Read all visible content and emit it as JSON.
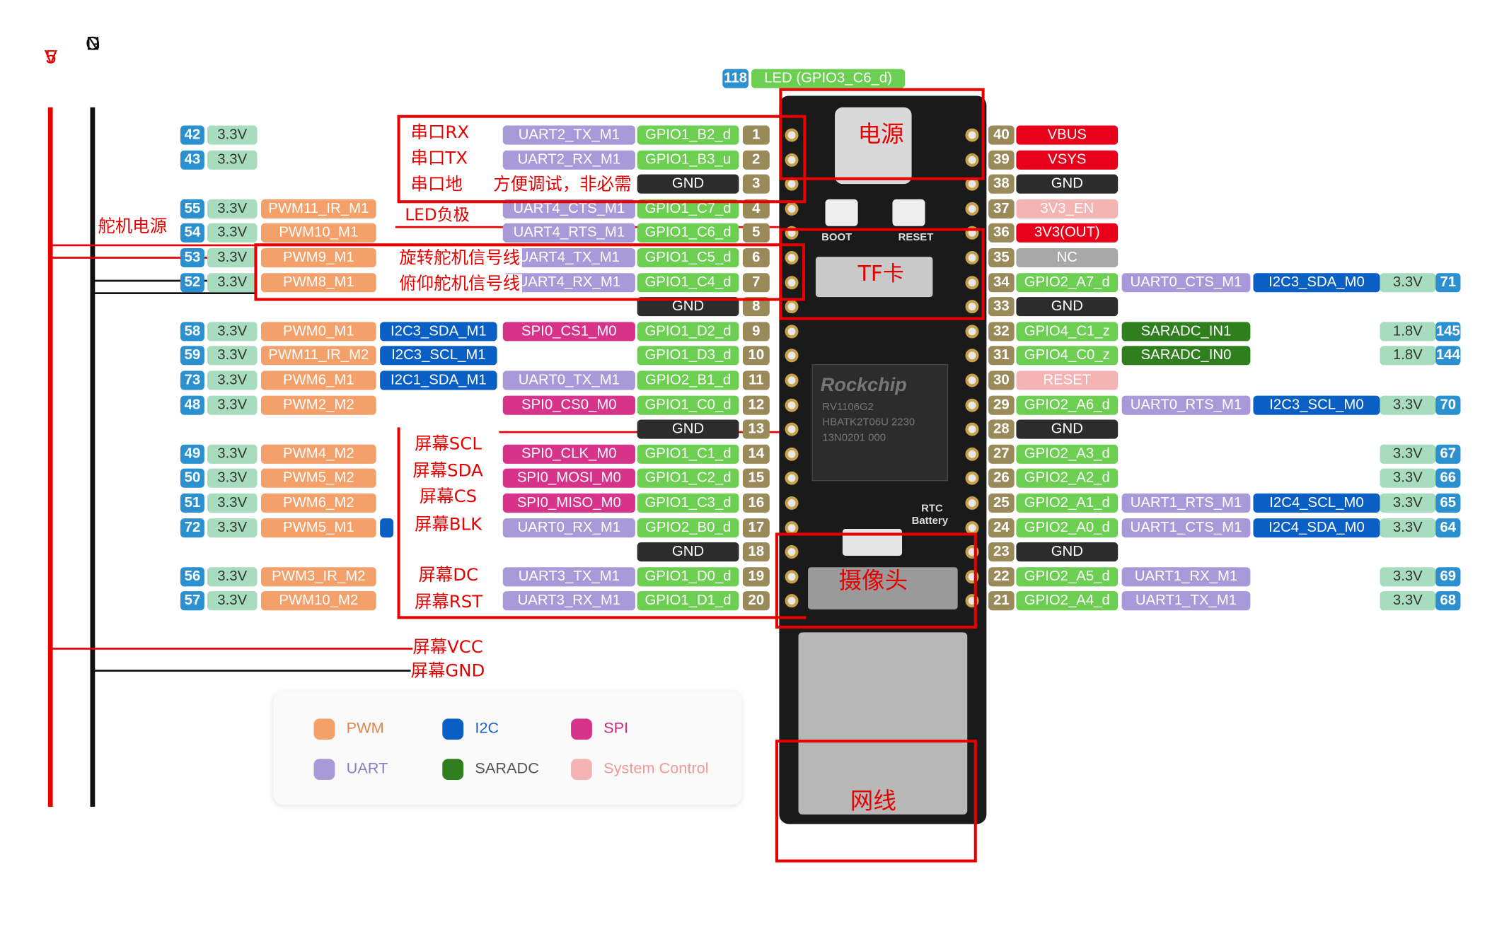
{
  "colors": {
    "power": "#a8dcbf",
    "pwm": "#f4a06a",
    "i2c": "#0a5fc4",
    "spi": "#d8338a",
    "uart": "#a89ad8",
    "gpio": "#6ccf52",
    "gnd": "#2c2c2c",
    "pinnum": "#9a8a5a",
    "idnum": "#2a90d0",
    "red": "#e8001a",
    "sysctrl": "#f5b4b4",
    "nc": "#a8a8a8",
    "saradc": "#2f7f1f",
    "annot": "#e60000"
  },
  "rails": {
    "v5": [
      "5",
      "V"
    ],
    "gnd": [
      "G",
      "N",
      "D"
    ]
  },
  "led_pin": {
    "num": "118",
    "label": "LED (GPIO3_C6_d)"
  },
  "left_pins": [
    {
      "row": 0,
      "pin": "1",
      "gpio": "GPIO1_B2_d",
      "id": "42",
      "cells": [
        {
          "t": "3.3V",
          "c": "power",
          "col": "v33"
        },
        {
          "t": "UART2_TX_M1",
          "c": "uart",
          "col": "f4"
        }
      ]
    },
    {
      "row": 1,
      "pin": "2",
      "gpio": "GPIO1_B3_u",
      "id": "43",
      "cells": [
        {
          "t": "3.3V",
          "c": "power",
          "col": "v33"
        },
        {
          "t": "UART2_RX_M1",
          "c": "uart",
          "col": "f4"
        }
      ]
    },
    {
      "row": 2,
      "pin": "3",
      "gpio": "GND",
      "gnd": true,
      "cells": []
    },
    {
      "row": 3,
      "pin": "4",
      "gpio": "GPIO1_C7_d",
      "id": "55",
      "cells": [
        {
          "t": "3.3V",
          "c": "power",
          "col": "v33"
        },
        {
          "t": "PWM11_IR_M1",
          "c": "pwm",
          "col": "f1"
        },
        {
          "t": "UART4_CTS_M1",
          "c": "uart",
          "col": "f4"
        }
      ]
    },
    {
      "row": 4,
      "pin": "5",
      "gpio": "GPIO1_C6_d",
      "id": "54",
      "cells": [
        {
          "t": "3.3V",
          "c": "power",
          "col": "v33"
        },
        {
          "t": "PWM10_M1",
          "c": "pwm",
          "col": "f1"
        },
        {
          "t": "UART4_RTS_M1",
          "c": "uart",
          "col": "f4"
        }
      ]
    },
    {
      "row": 5,
      "pin": "6",
      "gpio": "GPIO1_C5_d",
      "id": "53",
      "cells": [
        {
          "t": "3.3V",
          "c": "power",
          "col": "v33"
        },
        {
          "t": "PWM9_M1",
          "c": "pwm",
          "col": "f1"
        },
        {
          "t": "UART4_TX_M1",
          "c": "uart",
          "col": "f4"
        }
      ]
    },
    {
      "row": 6,
      "pin": "7",
      "gpio": "GPIO1_C4_d",
      "id": "52",
      "cells": [
        {
          "t": "3.3V",
          "c": "power",
          "col": "v33"
        },
        {
          "t": "PWM8_M1",
          "c": "pwm",
          "col": "f1"
        },
        {
          "t": "UART4_RX_M1",
          "c": "uart",
          "col": "f4"
        }
      ]
    },
    {
      "row": 7,
      "pin": "8",
      "gpio": "GND",
      "gnd": true,
      "cells": []
    },
    {
      "row": 8,
      "pin": "9",
      "gpio": "GPIO1_D2_d",
      "id": "58",
      "cells": [
        {
          "t": "3.3V",
          "c": "power",
          "col": "v33"
        },
        {
          "t": "PWM0_M1",
          "c": "pwm",
          "col": "f1"
        },
        {
          "t": "I2C3_SDA_M1",
          "c": "i2c",
          "col": "f2"
        },
        {
          "t": "SPI0_CS1_M0",
          "c": "spi",
          "col": "f4"
        }
      ]
    },
    {
      "row": 9,
      "pin": "10",
      "gpio": "GPIO1_D3_d",
      "id": "59",
      "cells": [
        {
          "t": "3.3V",
          "c": "power",
          "col": "v33"
        },
        {
          "t": "PWM11_IR_M2",
          "c": "pwm",
          "col": "f1"
        },
        {
          "t": "I2C3_SCL_M1",
          "c": "i2c",
          "col": "f2"
        }
      ]
    },
    {
      "row": 10,
      "pin": "11",
      "gpio": "GPIO2_B1_d",
      "id": "73",
      "cells": [
        {
          "t": "3.3V",
          "c": "power",
          "col": "v33"
        },
        {
          "t": "PWM6_M1",
          "c": "pwm",
          "col": "f1"
        },
        {
          "t": "I2C1_SDA_M1",
          "c": "i2c",
          "col": "f2"
        },
        {
          "t": "UART0_TX_M1",
          "c": "uart",
          "col": "f4"
        }
      ]
    },
    {
      "row": 11,
      "pin": "12",
      "gpio": "GPIO1_C0_d",
      "id": "48",
      "cells": [
        {
          "t": "3.3V",
          "c": "power",
          "col": "v33"
        },
        {
          "t": "PWM2_M2",
          "c": "pwm",
          "col": "f1"
        },
        {
          "t": "SPI0_CS0_M0",
          "c": "spi",
          "col": "f4"
        }
      ]
    },
    {
      "row": 12,
      "pin": "13",
      "gpio": "GND",
      "gnd": true,
      "cells": []
    },
    {
      "row": 13,
      "pin": "14",
      "gpio": "GPIO1_C1_d",
      "id": "49",
      "cells": [
        {
          "t": "3.3V",
          "c": "power",
          "col": "v33"
        },
        {
          "t": "PWM4_M2",
          "c": "pwm",
          "col": "f1"
        },
        {
          "t": "SPI0_CLK_M0",
          "c": "spi",
          "col": "f4"
        }
      ]
    },
    {
      "row": 14,
      "pin": "15",
      "gpio": "GPIO1_C2_d",
      "id": "50",
      "cells": [
        {
          "t": "3.3V",
          "c": "power",
          "col": "v33"
        },
        {
          "t": "PWM5_M2",
          "c": "pwm",
          "col": "f1"
        },
        {
          "t": "SPI0_MOSI_M0",
          "c": "spi",
          "col": "f4"
        }
      ]
    },
    {
      "row": 15,
      "pin": "16",
      "gpio": "GPIO1_C3_d",
      "id": "51",
      "cells": [
        {
          "t": "3.3V",
          "c": "power",
          "col": "v33"
        },
        {
          "t": "PWM6_M2",
          "c": "pwm",
          "col": "f1"
        },
        {
          "t": "SPI0_MISO_M0",
          "c": "spi",
          "col": "f4"
        }
      ]
    },
    {
      "row": 16,
      "pin": "17",
      "gpio": "GPIO2_B0_d",
      "id": "72",
      "cells": [
        {
          "t": "3.3V",
          "c": "power",
          "col": "v33"
        },
        {
          "t": "PWM5_M1",
          "c": "pwm",
          "col": "f1"
        },
        {
          "t": "",
          "c": "i2c",
          "col": "f2stub"
        },
        {
          "t": "UART0_RX_M1",
          "c": "uart",
          "col": "f4"
        }
      ]
    },
    {
      "row": 17,
      "pin": "18",
      "gpio": "GND",
      "gnd": true,
      "cells": []
    },
    {
      "row": 18,
      "pin": "19",
      "gpio": "GPIO1_D0_d",
      "id": "56",
      "cells": [
        {
          "t": "3.3V",
          "c": "power",
          "col": "v33"
        },
        {
          "t": "PWM3_IR_M2",
          "c": "pwm",
          "col": "f1"
        },
        {
          "t": "UART3_TX_M1",
          "c": "uart",
          "col": "f4"
        }
      ]
    },
    {
      "row": 19,
      "pin": "20",
      "gpio": "GPIO1_D1_d",
      "id": "57",
      "cells": [
        {
          "t": "3.3V",
          "c": "power",
          "col": "v33"
        },
        {
          "t": "PWM10_M2",
          "c": "pwm",
          "col": "f1"
        },
        {
          "t": "UART3_RX_M1",
          "c": "uart",
          "col": "f4"
        }
      ]
    }
  ],
  "right_pins": [
    {
      "row": 0,
      "pin": "40",
      "label": "VBUS",
      "c": "red",
      "cells": []
    },
    {
      "row": 1,
      "pin": "39",
      "label": "VSYS",
      "c": "red",
      "cells": []
    },
    {
      "row": 2,
      "pin": "38",
      "label": "GND",
      "c": "gnd",
      "cells": []
    },
    {
      "row": 3,
      "pin": "37",
      "label": "3V3_EN",
      "c": "sysctrl",
      "cells": []
    },
    {
      "row": 4,
      "pin": "36",
      "label": "3V3(OUT)",
      "c": "red",
      "cells": []
    },
    {
      "row": 5,
      "pin": "35",
      "label": "NC",
      "c": "nc",
      "cells": []
    },
    {
      "row": 6,
      "pin": "34",
      "label": "GPIO2_A7_d",
      "c": "gpio",
      "id": "71",
      "cells": [
        {
          "t": "UART0_CTS_M1",
          "c": "uart",
          "col": "r1"
        },
        {
          "t": "I2C3_SDA_M0",
          "c": "i2c",
          "col": "r2"
        },
        {
          "t": "3.3V",
          "c": "power",
          "col": "rv"
        }
      ]
    },
    {
      "row": 7,
      "pin": "33",
      "label": "GND",
      "c": "gnd",
      "cells": []
    },
    {
      "row": 8,
      "pin": "32",
      "label": "GPIO4_C1_z",
      "c": "gpio",
      "id": "145",
      "cells": [
        {
          "t": "SARADC_IN1",
          "c": "saradc",
          "col": "r1"
        },
        {
          "t": "1.8V",
          "c": "power",
          "col": "rv"
        }
      ]
    },
    {
      "row": 9,
      "pin": "31",
      "label": "GPIO4_C0_z",
      "c": "gpio",
      "id": "144",
      "cells": [
        {
          "t": "SARADC_IN0",
          "c": "saradc",
          "col": "r1"
        },
        {
          "t": "1.8V",
          "c": "power",
          "col": "rv"
        }
      ]
    },
    {
      "row": 10,
      "pin": "30",
      "label": "RESET",
      "c": "sysctrl",
      "cells": []
    },
    {
      "row": 11,
      "pin": "29",
      "label": "GPIO2_A6_d",
      "c": "gpio",
      "id": "70",
      "cells": [
        {
          "t": "UART0_RTS_M1",
          "c": "uart",
          "col": "r1"
        },
        {
          "t": "I2C3_SCL_M0",
          "c": "i2c",
          "col": "r2"
        },
        {
          "t": "3.3V",
          "c": "power",
          "col": "rv"
        }
      ]
    },
    {
      "row": 12,
      "pin": "28",
      "label": "GND",
      "c": "gnd",
      "cells": []
    },
    {
      "row": 13,
      "pin": "27",
      "label": "GPIO2_A3_d",
      "c": "gpio",
      "id": "67",
      "cells": [
        {
          "t": "3.3V",
          "c": "power",
          "col": "rv"
        }
      ]
    },
    {
      "row": 14,
      "pin": "26",
      "label": "GPIO2_A2_d",
      "c": "gpio",
      "id": "66",
      "cells": [
        {
          "t": "3.3V",
          "c": "power",
          "col": "rv"
        }
      ]
    },
    {
      "row": 15,
      "pin": "25",
      "label": "GPIO2_A1_d",
      "c": "gpio",
      "id": "65",
      "cells": [
        {
          "t": "UART1_RTS_M1",
          "c": "uart",
          "col": "r1"
        },
        {
          "t": "I2C4_SCL_M0",
          "c": "i2c",
          "col": "r2"
        },
        {
          "t": "3.3V",
          "c": "power",
          "col": "rv"
        }
      ]
    },
    {
      "row": 16,
      "pin": "24",
      "label": "GPIO2_A0_d",
      "c": "gpio",
      "id": "64",
      "cells": [
        {
          "t": "UART1_CTS_M1",
          "c": "uart",
          "col": "r1"
        },
        {
          "t": "I2C4_SDA_M0",
          "c": "i2c",
          "col": "r2"
        },
        {
          "t": "3.3V",
          "c": "power",
          "col": "rv"
        }
      ]
    },
    {
      "row": 17,
      "pin": "23",
      "label": "GND",
      "c": "gnd",
      "cells": []
    },
    {
      "row": 18,
      "pin": "22",
      "label": "GPIO2_A5_d",
      "c": "gpio",
      "id": "69",
      "cells": [
        {
          "t": "UART1_RX_M1",
          "c": "uart",
          "col": "r1"
        },
        {
          "t": "3.3V",
          "c": "power",
          "col": "rv"
        }
      ]
    },
    {
      "row": 19,
      "pin": "21",
      "label": "GPIO2_A4_d",
      "c": "gpio",
      "id": "68",
      "cells": [
        {
          "t": "UART1_TX_M1",
          "c": "uart",
          "col": "r1"
        },
        {
          "t": "3.3V",
          "c": "power",
          "col": "rv"
        }
      ]
    }
  ],
  "annotations": {
    "uart_rx": "串口RX",
    "uart_tx": "串口TX",
    "uart_gnd": "串口地",
    "debug_note": "方便调试，非必需",
    "led_neg": "LED负极",
    "servo_power": "舵机电源",
    "rotate_servo": "旋转舵机信号线",
    "pitch_servo": "俯仰舵机信号线",
    "screen_scl": "屏幕SCL",
    "screen_sda": "屏幕SDA",
    "screen_cs": "屏幕CS",
    "screen_blk": "屏幕BLK",
    "screen_dc": "屏幕DC",
    "screen_rst": "屏幕RST",
    "screen_vcc": "屏幕VCC",
    "screen_gnd": "屏幕GND",
    "power_label": "电源",
    "tf_card": "TF卡",
    "camera": "摄像头",
    "network": "网线"
  },
  "board": {
    "chip_brand": "Rockchip",
    "chip_model": "RV1106G2",
    "chip_code": "HBATK2T06U 2230",
    "chip_lot": "13N0201 000",
    "boot": "BOOT",
    "reset": "RESET",
    "rtc": "RTC",
    "battery": "Battery"
  },
  "legend": [
    {
      "label": "PWM",
      "color": "#f4a06a",
      "text_color": "#e0864e"
    },
    {
      "label": "I2C",
      "color": "#0a5fc4",
      "text_color": "#1a64c0"
    },
    {
      "label": "SPI",
      "color": "#d8338a",
      "text_color": "#c82a7c"
    },
    {
      "label": "UART",
      "color": "#a89ad8",
      "text_color": "#8c7cc8"
    },
    {
      "label": "SARADC",
      "color": "#2f7f1f",
      "text_color": "#555555"
    },
    {
      "label": "System Control",
      "color": "#f5b4b4",
      "text_color": "#f09a9a"
    }
  ]
}
